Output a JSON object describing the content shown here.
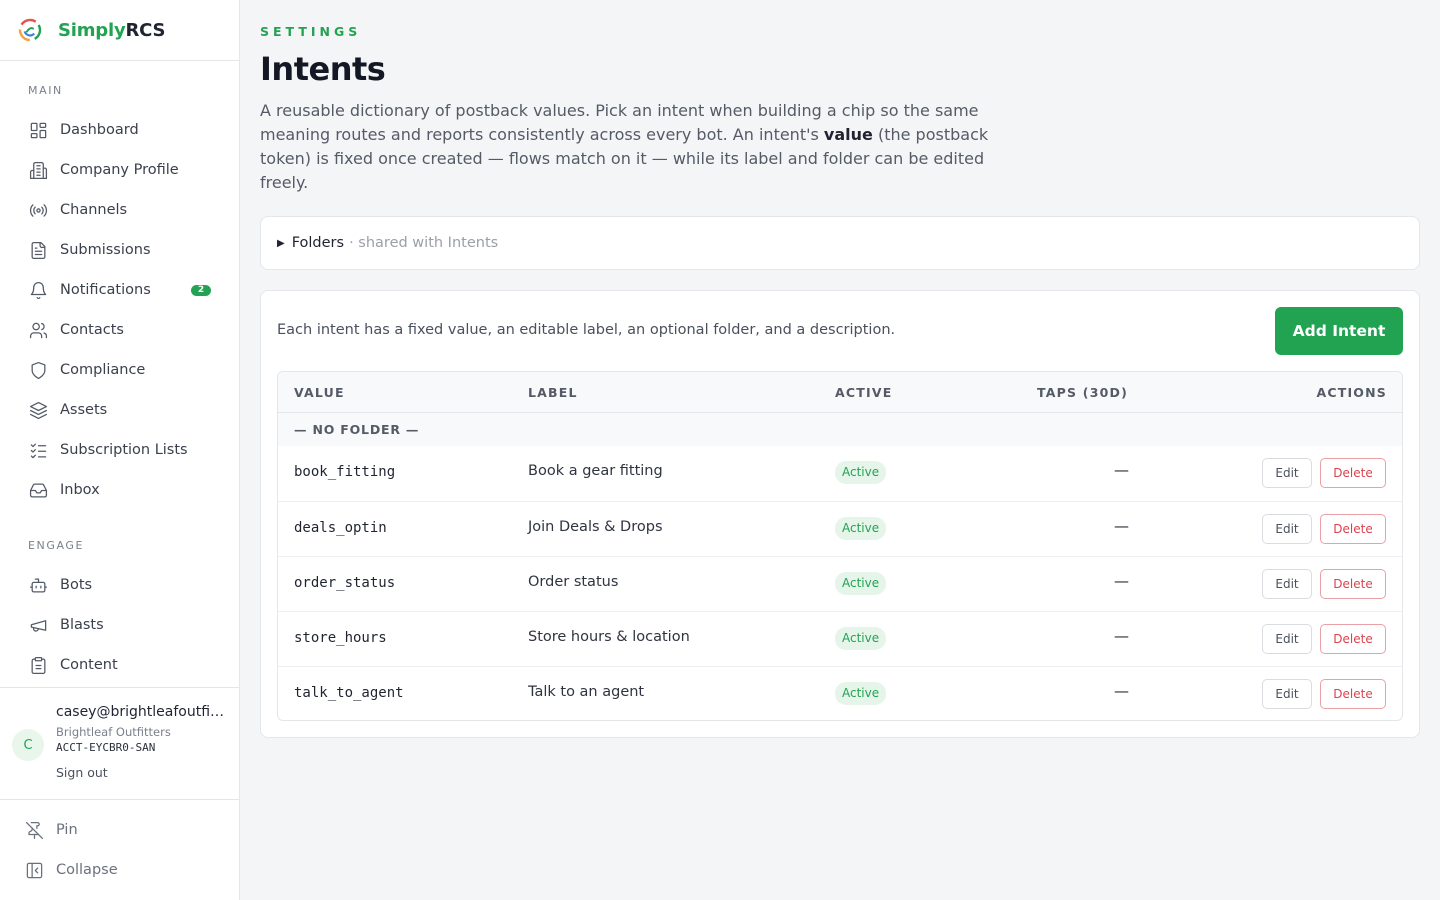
{
  "brand": {
    "name_part1": "Simply",
    "name_part2": "RCS",
    "accent": "#22a352"
  },
  "sidebar": {
    "sections": [
      {
        "title": "MAIN",
        "items": [
          {
            "label": "Dashboard",
            "icon": "dashboard-icon"
          },
          {
            "label": "Company Profile",
            "icon": "building-icon"
          },
          {
            "label": "Channels",
            "icon": "broadcast-icon"
          },
          {
            "label": "Submissions",
            "icon": "document-icon"
          },
          {
            "label": "Notifications",
            "icon": "bell-icon",
            "badge": "2"
          },
          {
            "label": "Contacts",
            "icon": "users-icon"
          },
          {
            "label": "Compliance",
            "icon": "shield-icon"
          },
          {
            "label": "Assets",
            "icon": "layers-icon"
          },
          {
            "label": "Subscription Lists",
            "icon": "checklist-icon"
          },
          {
            "label": "Inbox",
            "icon": "inbox-icon"
          }
        ]
      },
      {
        "title": "ENGAGE",
        "items": [
          {
            "label": "Bots",
            "icon": "bot-icon"
          },
          {
            "label": "Blasts",
            "icon": "megaphone-icon"
          },
          {
            "label": "Content",
            "icon": "clipboard-icon"
          }
        ]
      }
    ],
    "user": {
      "initial": "C",
      "email": "casey@brightleafoutfitters.com",
      "org": "Brightleaf Outfitters",
      "account": "ACCT-EYCBR0-SAN",
      "sign_out": "Sign out"
    },
    "footer": {
      "pin": "Pin",
      "collapse": "Collapse"
    }
  },
  "header": {
    "eyebrow": "SETTINGS",
    "title": "Intents",
    "desc_before": "A reusable dictionary of postback values. Pick an intent when building a chip so the same meaning routes and reports consistently across every bot. An intent's ",
    "desc_bold": "value",
    "desc_after": " (the postback token) is fixed once created — flows match on it — while its label and folder can be edited freely."
  },
  "folders": {
    "label": "Folders",
    "sub": "· shared with Intents"
  },
  "intents": {
    "intro": "Each intent has a fixed value, an editable label, an optional folder, and a description.",
    "add_label": "Add Intent",
    "columns": {
      "value": "VALUE",
      "label": "LABEL",
      "active": "ACTIVE",
      "taps": "TAPS (30D)",
      "actions": "ACTIONS"
    },
    "group": "— NO FOLDER —",
    "rows": [
      {
        "value": "book_fitting",
        "label": "Book a gear fitting",
        "status": "Active",
        "taps": "—",
        "edit": "Edit",
        "delete": "Delete"
      },
      {
        "value": "deals_optin",
        "label": "Join Deals & Drops",
        "status": "Active",
        "taps": "—",
        "edit": "Edit",
        "delete": "Delete"
      },
      {
        "value": "order_status",
        "label": "Order status",
        "status": "Active",
        "taps": "—",
        "edit": "Edit",
        "delete": "Delete"
      },
      {
        "value": "store_hours",
        "label": "Store hours & location",
        "status": "Active",
        "taps": "—",
        "edit": "Edit",
        "delete": "Delete"
      },
      {
        "value": "talk_to_agent",
        "label": "Talk to an agent",
        "status": "Active",
        "taps": "—",
        "edit": "Edit",
        "delete": "Delete"
      }
    ]
  }
}
